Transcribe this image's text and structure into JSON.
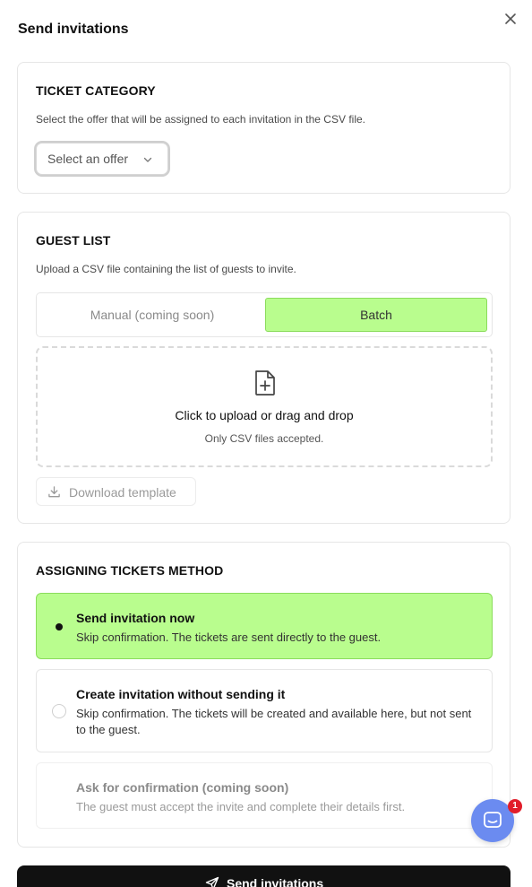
{
  "dialog": {
    "title": "Send invitations"
  },
  "ticket_category": {
    "title": "TICKET CATEGORY",
    "description": "Select the offer that will be assigned to each invitation in the CSV file.",
    "select_placeholder": "Select an offer"
  },
  "guest_list": {
    "title": "GUEST LIST",
    "description": "Upload a CSV file containing the list of guests to invite.",
    "toggle": {
      "manual_label": "Manual (coming soon)",
      "batch_label": "Batch",
      "selected": "Batch"
    },
    "dropzone": {
      "main_text": "Click to upload or drag and drop",
      "sub_text": "Only CSV files accepted."
    },
    "download_label": "Download template"
  },
  "method": {
    "title": "ASSIGNING TICKETS METHOD",
    "options": [
      {
        "title": "Send invitation now",
        "description": "Skip confirmation. The tickets are sent directly to the guest.",
        "selected": true
      },
      {
        "title": "Create invitation without sending it",
        "description": "Skip confirmation. The tickets will be created and available here, but not sent to the guest.",
        "selected": false
      },
      {
        "title": "Ask for confirmation (coming soon)",
        "description": "The guest must accept the invite and complete their details first.",
        "selected": false,
        "disabled": true
      }
    ]
  },
  "submit": {
    "label": "Send invitations"
  },
  "chat": {
    "badge_count": "1"
  },
  "colors": {
    "accent_green": "#b9fd8e",
    "accent_border": "#8bdc5c",
    "button_dark": "#111111",
    "chat_blue": "#6b8bf0",
    "badge_red": "#e11d2a"
  },
  "icons": [
    "close-icon",
    "chevron-down-icon",
    "file-plus-icon",
    "download-icon",
    "send-icon",
    "chat-icon"
  ]
}
